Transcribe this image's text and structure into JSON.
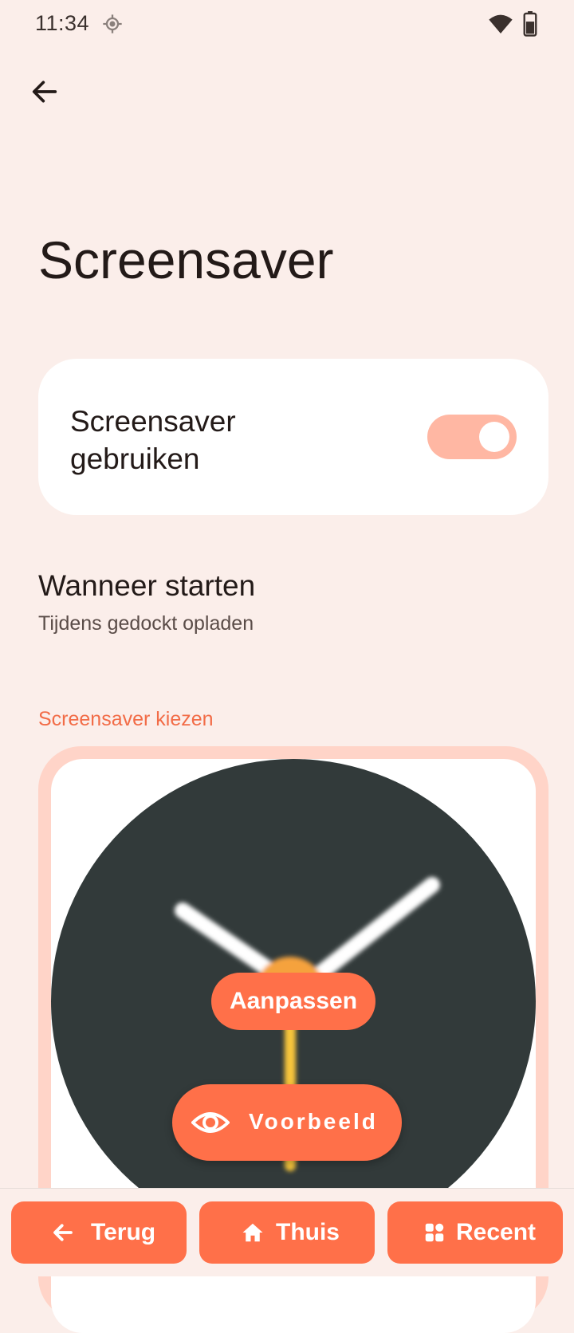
{
  "status_bar": {
    "time": "11:34"
  },
  "page": {
    "title": "Screensaver"
  },
  "toggle": {
    "label": "Screensaver gebruiken",
    "state": "on"
  },
  "when": {
    "title": "Wanneer starten",
    "subtitle": "Tijdens gedockt opladen"
  },
  "section": {
    "label": "Screensaver kiezen"
  },
  "preview": {
    "customize_label": "Aanpassen",
    "preview_label": "Voorbeeld"
  },
  "nav": {
    "back_label": "Terug",
    "home_label": "Thuis",
    "recent_label": "Recent"
  },
  "colors": {
    "accent": "#ff7049",
    "background": "#fbeeea",
    "switch_track": "#ffb7a3",
    "clock_face": "#323a3a",
    "clock_center": "#f5a23c",
    "second_hand": "#f7c63b"
  }
}
